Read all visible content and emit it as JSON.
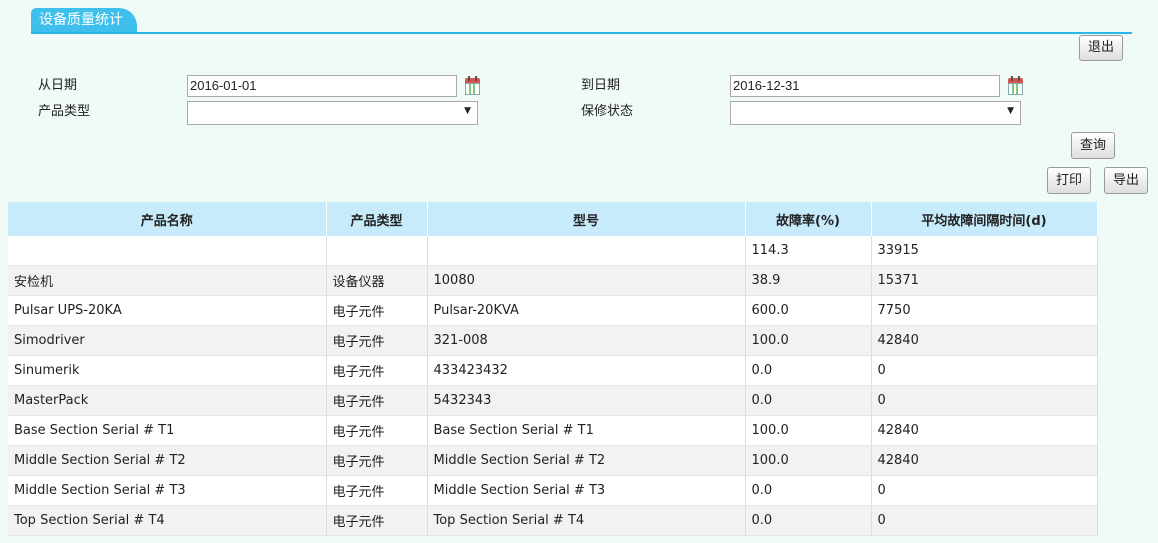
{
  "page": {
    "tab_title": "设备质量统计"
  },
  "buttons": {
    "exit": "退出",
    "query": "查询",
    "print": "打印",
    "export": "导出"
  },
  "filters": {
    "from_date_label": "从日期",
    "from_date_value": "2016-01-01",
    "to_date_label": "到日期",
    "to_date_value": "2016-12-31",
    "product_type_label": "产品类型",
    "product_type_value": "",
    "warranty_label": "保修状态",
    "warranty_value": ""
  },
  "table": {
    "headers": [
      "产品名称",
      "产品类型",
      "型号",
      "故障率(%)",
      "平均故障间隔时间(d)"
    ],
    "rows": [
      [
        "",
        "",
        "",
        "114.3",
        "33915"
      ],
      [
        "安检机",
        "设备仪器",
        "10080",
        "38.9",
        "15371"
      ],
      [
        "Pulsar UPS-20KA",
        "电子元件",
        "Pulsar-20KVA",
        "600.0",
        "7750"
      ],
      [
        "Simodriver",
        "电子元件",
        "321-008",
        "100.0",
        "42840"
      ],
      [
        "Sinumerik",
        "电子元件",
        "433423432",
        "0.0",
        "0"
      ],
      [
        "MasterPack",
        "电子元件",
        "5432343",
        "0.0",
        "0"
      ],
      [
        "Base Section Serial # T1",
        "电子元件",
        "Base Section Serial # T1",
        "100.0",
        "42840"
      ],
      [
        "Middle Section Serial # T2",
        "电子元件",
        "Middle Section Serial # T2",
        "100.0",
        "42840"
      ],
      [
        "Middle Section Serial # T3",
        "电子元件",
        "Middle Section Serial # T3",
        "0.0",
        "0"
      ],
      [
        "Top Section Serial # T4",
        "电子元件",
        "Top Section Serial # T4",
        "0.0",
        "0"
      ]
    ]
  },
  "icons": {
    "calendar": "calendar-icon",
    "dropdown": "chevron-down-icon"
  },
  "colors": {
    "tab": "#3fc0ec",
    "header_bg": "#c7ebfb",
    "page_bg": "#f0fbf7"
  }
}
